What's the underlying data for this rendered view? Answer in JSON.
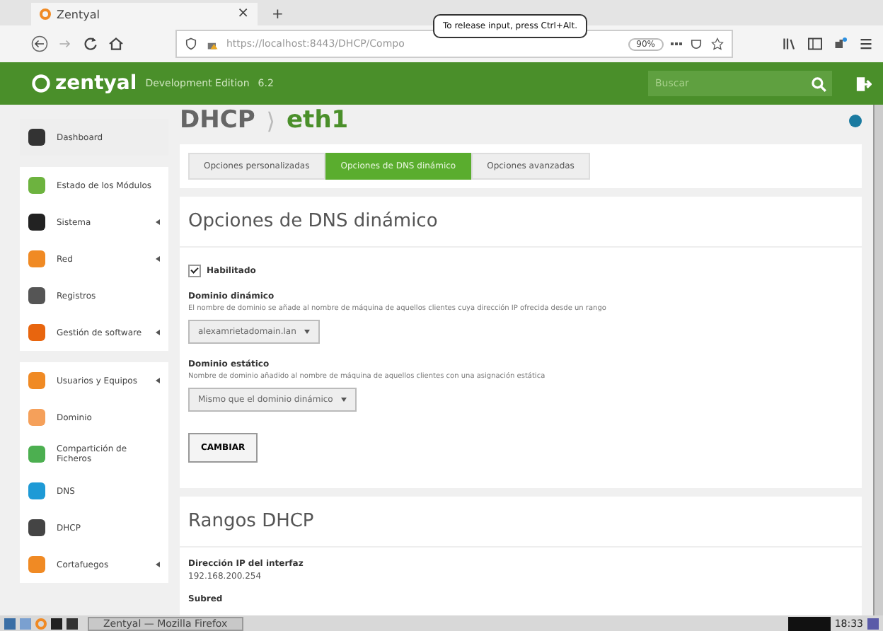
{
  "browser": {
    "tab": {
      "title": "Zentyal",
      "close": "×"
    },
    "new_tab": "+",
    "tooltip": "To release input, press Ctrl+Alt.",
    "url": "https://localhost:8443/DHCP/Compo",
    "zoom": "90%"
  },
  "header": {
    "logo": "zentyal",
    "edition": "Development Edition",
    "version": "6.2",
    "search": {
      "placeholder": "Buscar"
    }
  },
  "sidebar": {
    "groups": [
      [
        {
          "label": "Dashboard",
          "has_submenu": false,
          "color": "#333333"
        }
      ],
      [
        {
          "label": "Estado de los Módulos",
          "has_submenu": false,
          "color": "#6db33f"
        },
        {
          "label": "Sistema",
          "has_submenu": true,
          "color": "#222222"
        },
        {
          "label": "Red",
          "has_submenu": true,
          "color": "#f08a24"
        },
        {
          "label": "Registros",
          "has_submenu": false,
          "color": "#555555"
        },
        {
          "label": "Gestión de software",
          "has_submenu": true,
          "color": "#e8650e"
        }
      ],
      [
        {
          "label": "Usuarios y Equipos",
          "has_submenu": true,
          "color": "#f08a24"
        },
        {
          "label": "Dominio",
          "has_submenu": false,
          "color": "#f5a05a"
        },
        {
          "label": "Compartición de Ficheros",
          "has_submenu": false,
          "color": "#4caf50"
        },
        {
          "label": "DNS",
          "has_submenu": false,
          "color": "#1e9ad6"
        },
        {
          "label": "DHCP",
          "has_submenu": false,
          "color": "#444444"
        },
        {
          "label": "Cortafuegos",
          "has_submenu": true,
          "color": "#f08a24"
        }
      ]
    ]
  },
  "breadcrumb": {
    "parent": "DHCP",
    "separator": "⟩",
    "current": "eth1"
  },
  "tabs": [
    {
      "label": "Opciones personalizadas",
      "selected": false
    },
    {
      "label": "Opciones de DNS dinámico",
      "selected": true
    },
    {
      "label": "Opciones avanzadas",
      "selected": false
    }
  ],
  "dns_section": {
    "title": "Opciones de DNS dinámico",
    "enabled": {
      "label": "Habilitado",
      "checked": true
    },
    "dynamic_domain": {
      "label": "Dominio dinámico",
      "help": "El nombre de dominio se añade al nombre de máquina de aquellos clientes cuya dirección IP ofrecida desde un rango",
      "value": "alexamrietadomain.lan"
    },
    "static_domain": {
      "label": "Dominio estático",
      "help": "Nombre de dominio añadido al nombre de máquina de aquellos clientes con una asignación estática",
      "value": "Mismo que el dominio dinámico"
    },
    "button": "CAMBIAR"
  },
  "ranges_section": {
    "title": "Rangos DHCP",
    "fields": [
      {
        "label": "Dirección IP del interfaz",
        "value": "192.168.200.254"
      },
      {
        "label": "Subred"
      }
    ]
  },
  "taskbar": {
    "window": "Zentyal — Mozilla Firefox",
    "clock": "18:33"
  }
}
